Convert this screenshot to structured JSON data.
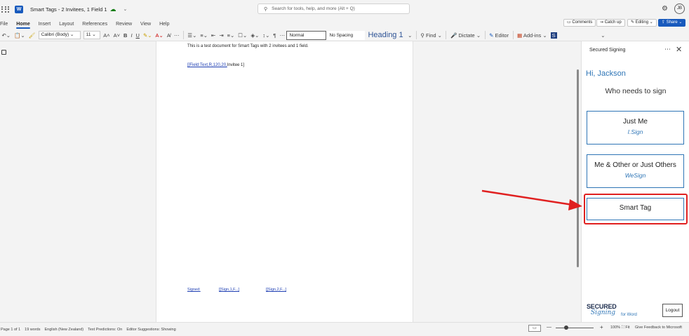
{
  "titlebar": {
    "app_letter": "W",
    "doc_title": "Smart Tags - 2 Invitees, 1 Field 1",
    "search_placeholder": "Search for tools, help, and more (Alt + Q)",
    "avatar_initials": "JB"
  },
  "menu": {
    "tabs": [
      "File",
      "Home",
      "Insert",
      "Layout",
      "References",
      "Review",
      "View",
      "Help"
    ],
    "active": "Home",
    "comments": "Comments",
    "catchup": "Catch up",
    "editing": "Editing",
    "share": "Share"
  },
  "ribbon": {
    "font": "Calibri (Body)",
    "size": "11",
    "styles": [
      "Normal",
      "No Spacing",
      "Heading 1"
    ],
    "find": "Find",
    "dictate": "Dictate",
    "editor": "Editor",
    "addins": "Add-ins"
  },
  "document": {
    "line1": "This is a test document for Smart Tags with 2 invitees and 1 field.",
    "field_code": "[[Field:Text,R,120,20,",
    "field_rest": "Invitee 1]",
    "sig_tags": [
      "Signed:",
      "[[Sign,1,F...]",
      "[[Sign,2,F...]"
    ]
  },
  "panel": {
    "title": "Secured Signing",
    "greeting": "Hi, Jackson",
    "question": "Who needs to sign",
    "options": [
      {
        "label": "Just Me",
        "logo": "I.Sign"
      },
      {
        "label": "Me & Other or Just Others",
        "logo": "WeSign"
      },
      {
        "label": "Smart Tag"
      }
    ],
    "brand_top": "SECURED",
    "brand_bottom": "Signing",
    "brand_suffix": "for Word",
    "logout": "Logout"
  },
  "status": {
    "page": "Page 1 of 1",
    "words": "19 words",
    "language": "English (New Zealand)",
    "predictions": "Text Predictions: On",
    "suggestions": "Editor Suggestions: Showing",
    "zoom": "100%",
    "fit": "Fit",
    "feedback": "Give Feedback to Microsoft"
  },
  "colors": {
    "brand_blue": "#185abd",
    "panel_accent": "#2e75b6",
    "highlight_red": "#e02020"
  }
}
